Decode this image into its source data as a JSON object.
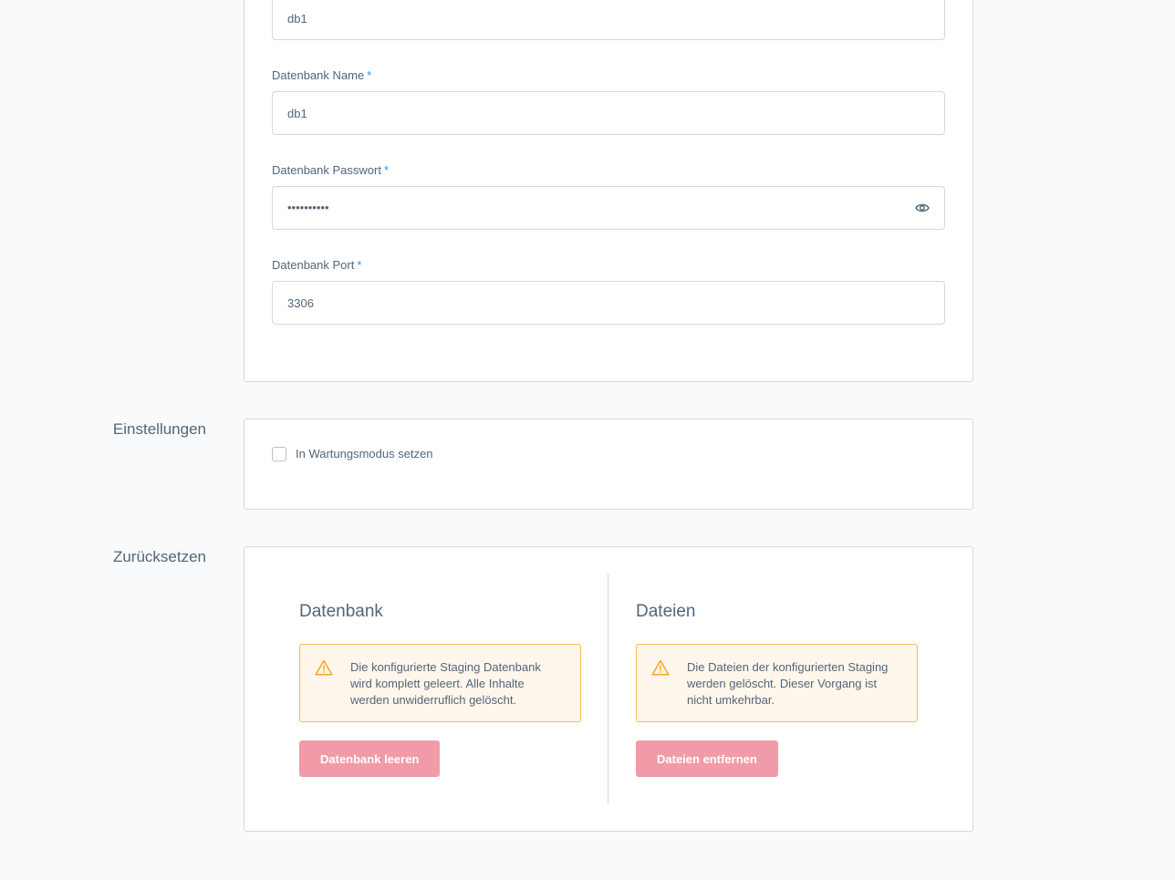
{
  "database": {
    "host_value": "db1",
    "name_label": "Datenbank Name",
    "name_value": "db1",
    "password_label": "Datenbank Passwort",
    "password_value": "••••••••••",
    "port_label": "Datenbank Port",
    "port_value": "3306",
    "required_marker": "*"
  },
  "settings": {
    "section_label": "Einstellungen",
    "maintenance_label": "In Wartungsmodus setzen",
    "maintenance_checked": false
  },
  "reset": {
    "section_label": "Zurücksetzen",
    "database": {
      "title": "Datenbank",
      "warning": "Die konfigurierte Staging Datenbank wird komplett geleert. Alle Inhalte werden unwiderruflich gelöscht.",
      "button_label": "Datenbank leeren"
    },
    "files": {
      "title": "Dateien",
      "warning": "Die Dateien der konfigurierten Staging werden gelöscht. Dieser Vorgang ist nicht umkehrbar.",
      "button_label": "Dateien entfernen"
    }
  },
  "colors": {
    "required": "#189eff",
    "warning_border": "#ffb75d",
    "warning_bg": "#fff6ec",
    "danger_button": "#f19ba8"
  },
  "icons": {
    "password_toggle": "eye-icon",
    "warning": "warning-icon"
  }
}
